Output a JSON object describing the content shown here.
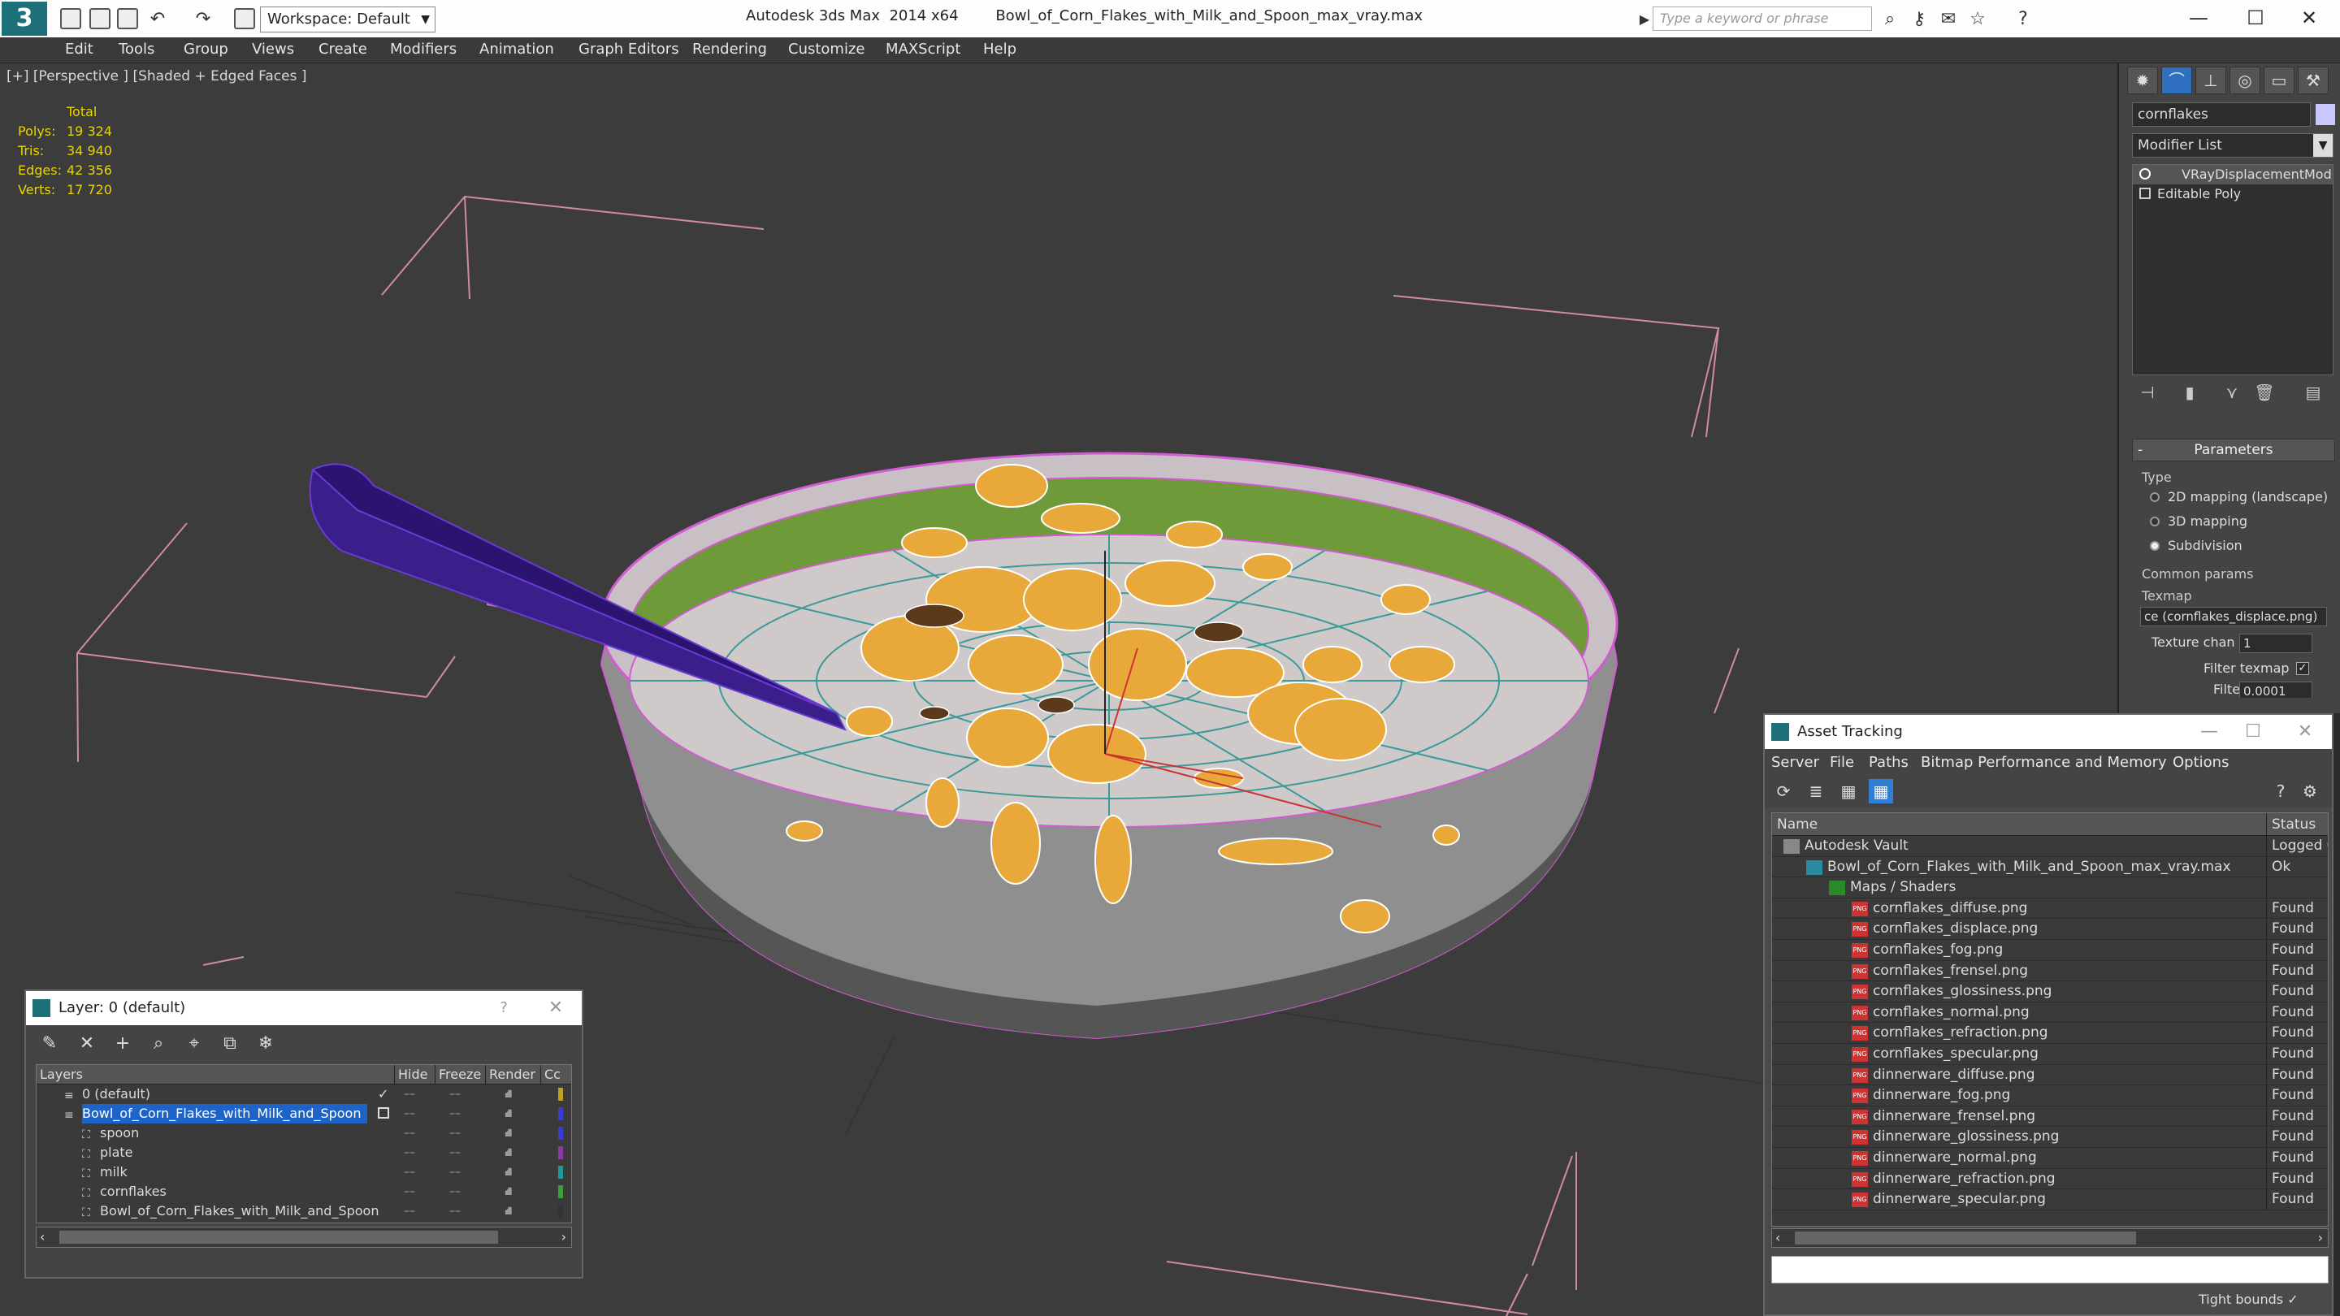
{
  "titlebar": {
    "workspace": "Workspace: Default",
    "app_name": "Autodesk 3ds Max  2014 x64",
    "file_name": "Bowl_of_Corn_Flakes_with_Milk_and_Spoon_max_vray.max",
    "search_placeholder": "Type a keyword or phrase",
    "minimize": "—",
    "maximize": "☐",
    "close": "✕"
  },
  "menubar": [
    "Edit",
    "Tools",
    "Group",
    "Views",
    "Create",
    "Modifiers",
    "Animation",
    "Graph Editors",
    "Rendering",
    "Customize",
    "MAXScript",
    "Help"
  ],
  "viewport": {
    "label": "[+] [Perspective ] [Shaded + Edged Faces ]",
    "stats": {
      "header": "Total",
      "rows": [
        {
          "label": "Polys:",
          "value": "19 324"
        },
        {
          "label": "Tris:",
          "value": "34 940"
        },
        {
          "label": "Edges:",
          "value": "42 356"
        },
        {
          "label": "Verts:",
          "value": "17 720"
        }
      ]
    }
  },
  "command_panel": {
    "object_name": "cornflakes",
    "modifier_list": "Modifier List",
    "stack": [
      "VRayDisplacementMod",
      "Editable Poly"
    ],
    "params_title": "Parameters",
    "type_label": "Type",
    "type_options": [
      "2D mapping (landscape)",
      "3D mapping",
      "Subdivision"
    ],
    "common_params": "Common params",
    "texmap_label": "Texmap",
    "texmap_value": "ce (cornflakes_displace.png)",
    "texture_chan_label": "Texture chan",
    "texture_chan_value": "1",
    "filter_texmap_label": "Filter texmap",
    "filter_blur_label": "Filter blur",
    "filter_blur_value": "0.0001"
  },
  "asset_tracking": {
    "title": "Asset Tracking",
    "menu": [
      "Server",
      "File",
      "Paths",
      "Bitmap Performance and Memory",
      "Options"
    ],
    "col_name": "Name",
    "col_status": "Status",
    "rows": [
      {
        "name": "Autodesk Vault",
        "status": "Logged C",
        "indent": 0
      },
      {
        "name": "Bowl_of_Corn_Flakes_with_Milk_and_Spoon_max_vray.max",
        "status": "Ok",
        "indent": 1
      },
      {
        "name": "Maps / Shaders",
        "status": "",
        "indent": 2
      },
      {
        "name": "cornflakes_diffuse.png",
        "status": "Found",
        "indent": 3
      },
      {
        "name": "cornflakes_displace.png",
        "status": "Found",
        "indent": 3
      },
      {
        "name": "cornflakes_fog.png",
        "status": "Found",
        "indent": 3
      },
      {
        "name": "cornflakes_frensel.png",
        "status": "Found",
        "indent": 3
      },
      {
        "name": "cornflakes_glossiness.png",
        "status": "Found",
        "indent": 3
      },
      {
        "name": "cornflakes_normal.png",
        "status": "Found",
        "indent": 3
      },
      {
        "name": "cornflakes_refraction.png",
        "status": "Found",
        "indent": 3
      },
      {
        "name": "cornflakes_specular.png",
        "status": "Found",
        "indent": 3
      },
      {
        "name": "dinnerware_diffuse.png",
        "status": "Found",
        "indent": 3
      },
      {
        "name": "dinnerware_fog.png",
        "status": "Found",
        "indent": 3
      },
      {
        "name": "dinnerware_frensel.png",
        "status": "Found",
        "indent": 3
      },
      {
        "name": "dinnerware_glossiness.png",
        "status": "Found",
        "indent": 3
      },
      {
        "name": "dinnerware_normal.png",
        "status": "Found",
        "indent": 3
      },
      {
        "name": "dinnerware_refraction.png",
        "status": "Found",
        "indent": 3
      },
      {
        "name": "dinnerware_specular.png",
        "status": "Found",
        "indent": 3
      }
    ],
    "tight_bounds": "Tight bounds"
  },
  "layer_manager": {
    "title": "Layer: 0 (default)",
    "help": "?",
    "close": "✕",
    "columns": [
      "Layers",
      "Hide",
      "Freeze",
      "Render",
      "Cc"
    ],
    "rows": [
      {
        "name": "0 (default)",
        "indent": 1,
        "selected": false
      },
      {
        "name": "Bowl_of_Corn_Flakes_with_Milk_and_Spoon",
        "indent": 1,
        "selected": true
      },
      {
        "name": "spoon",
        "indent": 2,
        "selected": false
      },
      {
        "name": "plate",
        "indent": 2,
        "selected": false
      },
      {
        "name": "milk",
        "indent": 2,
        "selected": false
      },
      {
        "name": "cornflakes",
        "indent": 2,
        "selected": false
      },
      {
        "name": "Bowl_of_Corn_Flakes_with_Milk_and_Spoon",
        "indent": 2,
        "selected": false
      }
    ]
  },
  "colors": {
    "accent": "#1e64c8",
    "wire": "#d25ad2",
    "flakes": "#e8a83a",
    "milk": "#cfc9c9",
    "bowl_inner": "#6e9a3a",
    "spoon": "#3a1f8a",
    "stats": "#e8d400"
  }
}
